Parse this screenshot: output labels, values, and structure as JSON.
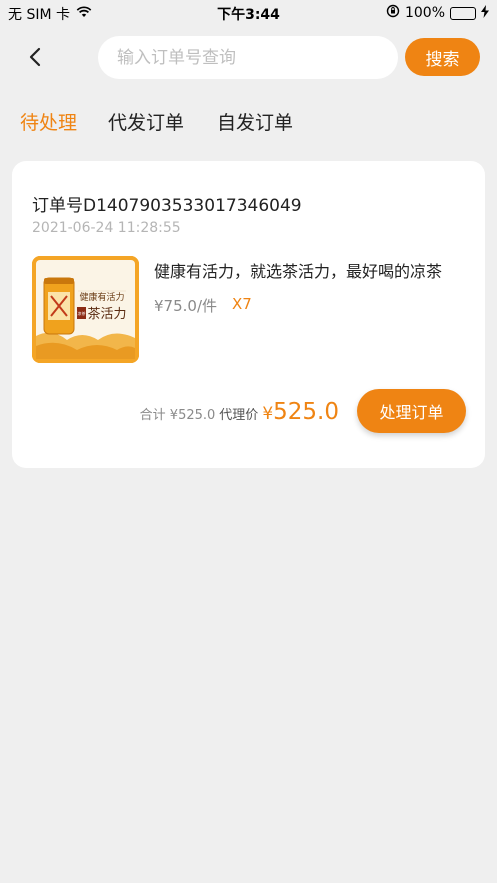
{
  "status_bar": {
    "carrier": "无 SIM 卡",
    "time": "下午3:44",
    "battery": "100%"
  },
  "header": {
    "search_placeholder": "输入订单号查询",
    "search_button": "搜索"
  },
  "tabs": [
    {
      "label": "待处理",
      "active": true
    },
    {
      "label": "代发订单",
      "active": false
    },
    {
      "label": "自发订单",
      "active": false
    }
  ],
  "order": {
    "number": "订单号D1407903533017346049",
    "time": "2021-06-24 11:28:55",
    "product_name": "健康有活力，就选茶活力，最好喝的凉茶",
    "unit_price": "¥75.0/件",
    "quantity": "X7",
    "total_label": "合计 ¥525.0",
    "agent_price_label": "代理价",
    "agent_price_symbol": "¥",
    "agent_price_value": "525.0",
    "process_button": "处理订单",
    "product_image": {
      "brand_text_top": "健康有活力",
      "brand_text_main": "茶活力",
      "seal_text": "凉茶"
    }
  },
  "colors": {
    "accent": "#ef8413",
    "background": "#efefef",
    "card": "#ffffff"
  }
}
